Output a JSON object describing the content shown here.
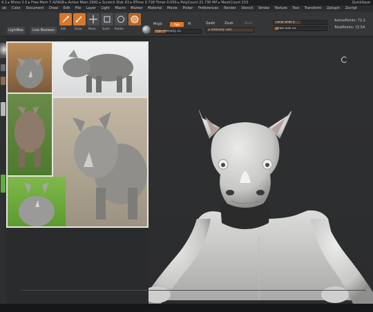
{
  "titlebar": {
    "left": "4.1 ▸ Rhino 2.0 ▸ Free Mem 7.429GB ▸ Active Mem 2692 ▸ Scratch Disk 63 ▸ RTime 0.728 Timer 0.059 ▸ PolyCount 21.730 MP ▸ MeshCount 153",
    "quicksave": "QuickSave"
  },
  "menubar": [
    "ob",
    "Color",
    "Document",
    "Draw",
    "Edit",
    "File",
    "Layer",
    "Light",
    "Macro",
    "Marker",
    "Material",
    "Movie",
    "Picker",
    "Preferences",
    "Render",
    "Stencil",
    "Stroke",
    "Texture",
    "Tool",
    "Transform",
    "Zplugin",
    "Zscript"
  ],
  "toolbar": {
    "lightbox": "LightBox",
    "live_boolean": "Live Boolean",
    "tool_labels": [
      "Edit",
      "Draw",
      "Move",
      "Scale",
      "Rotate"
    ],
    "mrgb": "Mrgb",
    "rgb": "Rgb",
    "m": "M",
    "rgb_intensity": "Rgb Intensity 25",
    "zadd": "Zadd",
    "zsub": "Zsub",
    "zcut": "Zcut",
    "z_intensity": "Z Intensity 100",
    "focal_shift": "Focal Shift 0",
    "draw_size": "Draw Size 22",
    "active_points": "ActivePoints: 72,1",
    "total_points": "TotalPoints: 72.54"
  },
  "colors": {
    "accent": "#d9772b",
    "bg": "#2a2b2d",
    "toolbar": "#353638",
    "clay": "#d6d6d4",
    "collar": "#2b2b2c"
  },
  "icons": [
    "lightbox-button",
    "edit-icon",
    "draw-icon",
    "move-icon",
    "scale-icon",
    "rotate-icon",
    "material-sphere-icon",
    "rotate-cursor-icon"
  ]
}
